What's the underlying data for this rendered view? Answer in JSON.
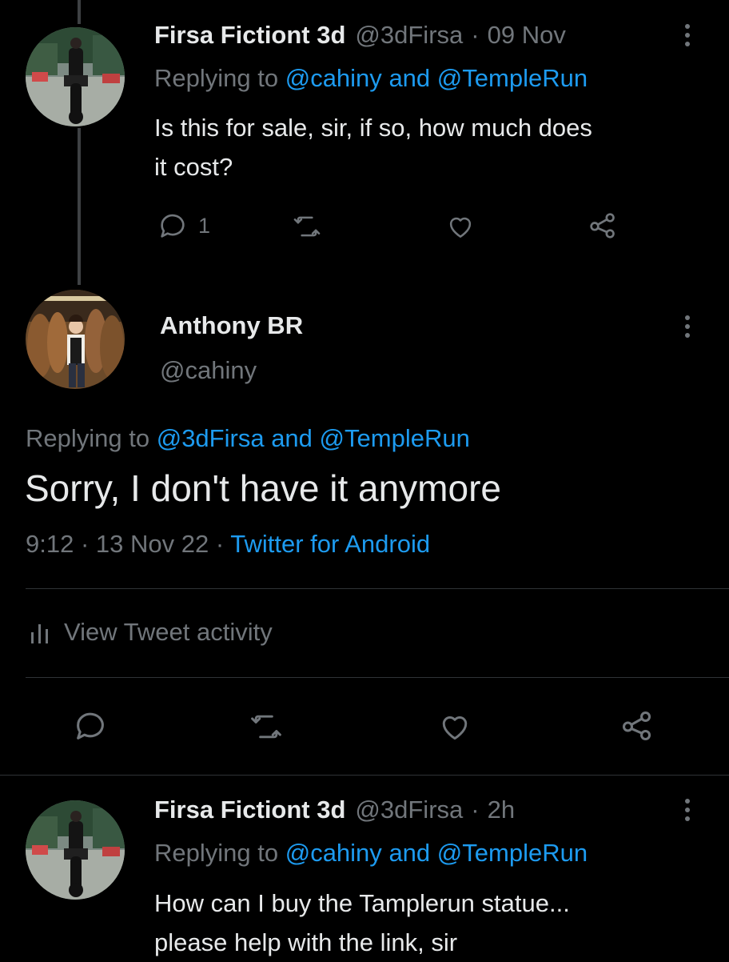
{
  "colors": {
    "background": "#000000",
    "text": "#e7e9ea",
    "muted": "#71767b",
    "accent": "#1d9bf0",
    "divider": "#2f3336"
  },
  "tweet1": {
    "name": "Firsa Fictiont 3d",
    "handle": "@3dFirsa",
    "sep": "·",
    "time": "09 Nov",
    "replying_prefix": "Replying to",
    "reply_mention_1": "@cahiny",
    "reply_and": "and",
    "reply_mention_2": "@TempleRun",
    "text_line1": "Is this for sale, sir, if so, how much does",
    "text_line2": "it cost?",
    "reply_count": "1",
    "icons": [
      "reply-icon",
      "retweet-icon",
      "like-icon",
      "share-icon"
    ]
  },
  "main_tweet": {
    "name": "Anthony BR",
    "handle": "@cahiny",
    "replying_prefix": "Replying to",
    "reply_mention_1": "@3dFirsa",
    "reply_and": "and",
    "reply_mention_2": "@TempleRun",
    "text": "Sorry, I don't have it anymore",
    "time": "9:12",
    "sep1": "·",
    "date": "13 Nov 22",
    "sep2": "·",
    "source": "Twitter for Android",
    "activity_label": "View Tweet activity",
    "icons": [
      "reply-icon",
      "retweet-icon",
      "like-icon",
      "share-icon"
    ]
  },
  "tweet3": {
    "name": "Firsa Fictiont 3d",
    "handle": "@3dFirsa",
    "sep": "·",
    "time": "2h",
    "replying_prefix": "Replying to",
    "reply_mention_1": "@cahiny",
    "reply_and": "and",
    "reply_mention_2": "@TempleRun",
    "text_line1": "How can I buy the Tamplerun statue...",
    "text_line2": "please help with the link, sir"
  }
}
